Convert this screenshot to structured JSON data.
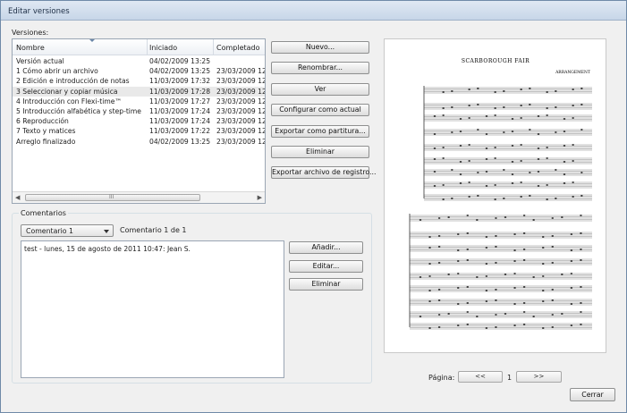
{
  "window": {
    "title": "Editar versiones"
  },
  "versions": {
    "label": "Versiones:",
    "columns": [
      "Nombre",
      "Iniciado",
      "Completado"
    ],
    "rows": [
      {
        "name": "Versión actual",
        "started": "04/02/2009 13:25",
        "completed": ""
      },
      {
        "name": "1 Cómo abrir un archivo",
        "started": "04/02/2009 13:25",
        "completed": "23/03/2009 12:2"
      },
      {
        "name": "2 Edición e introducción de notas",
        "started": "11/03/2009 17:32",
        "completed": "23/03/2009 12:2"
      },
      {
        "name": "3 Seleccionar y copiar música",
        "started": "11/03/2009 17:28",
        "completed": "23/03/2009 12:2"
      },
      {
        "name": "4 Introducción con Flexi-time™",
        "started": "11/03/2009 17:27",
        "completed": "23/03/2009 12:2"
      },
      {
        "name": "5 Introducción alfabética y step-time",
        "started": "11/03/2009 17:24",
        "completed": "23/03/2009 12:2"
      },
      {
        "name": "6 Reproducción",
        "started": "11/03/2009 17:24",
        "completed": "23/03/2009 12:2"
      },
      {
        "name": "7 Texto y matices",
        "started": "11/03/2009 17:22",
        "completed": "23/03/2009 12:2"
      },
      {
        "name": "Arreglo finalizado",
        "started": "04/02/2009 13:25",
        "completed": "23/03/2009 12:2"
      }
    ],
    "selected_index": 3
  },
  "version_buttons": {
    "new": "Nuevo...",
    "rename": "Renombrar...",
    "view": "Ver",
    "set_current": "Configurar como actual",
    "export_score": "Exportar como partitura...",
    "delete": "Eliminar",
    "export_log": "Exportar archivo de registro..."
  },
  "comments": {
    "label": "Comentarios",
    "selected": "Comentario 1",
    "counter": "Comentario 1 de 1",
    "text": "test - lunes, 15 de agosto de 2011 10:47: Jean S.",
    "add": "Añadir...",
    "edit": "Editar...",
    "delete": "Eliminar"
  },
  "preview": {
    "score_title": "SCARBOROUGH FAIR",
    "score_subtitle": "ARRANGEMENT"
  },
  "pager": {
    "label": "Página:",
    "prev": "<<",
    "page": "1",
    "next": ">>"
  },
  "footer": {
    "close": "Cerrar"
  }
}
